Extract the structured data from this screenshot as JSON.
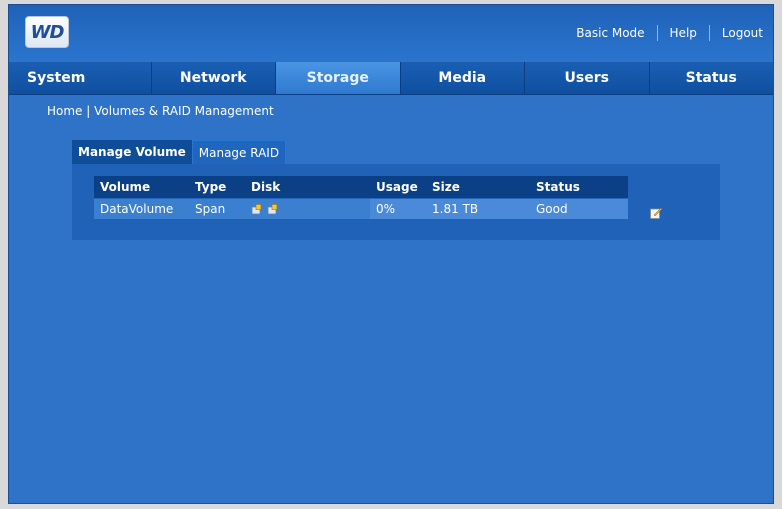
{
  "header": {
    "logo": "WD",
    "links": [
      "Basic Mode",
      "Help",
      "Logout"
    ]
  },
  "nav": {
    "tabs": [
      "System",
      "Network",
      "Storage",
      "Media",
      "Users",
      "Status"
    ],
    "active": "Storage"
  },
  "breadcrumb": "Home | Volumes & RAID Management",
  "subtabs": [
    "Manage Volume",
    "Manage RAID"
  ],
  "table": {
    "columns": [
      "Volume",
      "Type",
      "Disk",
      "Usage",
      "Size",
      "Status"
    ],
    "rows": [
      {
        "volume": "DataVolume",
        "type": "Span",
        "usage": "0%",
        "size": "1.81 TB",
        "status": "Good"
      }
    ]
  },
  "icons": {
    "disk": "disk-info-icon",
    "edit": "edit-volume-icon"
  },
  "colors": {
    "background": "#2f73c8",
    "nav": "#1a5fb4",
    "active_tab": "#4b95e4"
  }
}
